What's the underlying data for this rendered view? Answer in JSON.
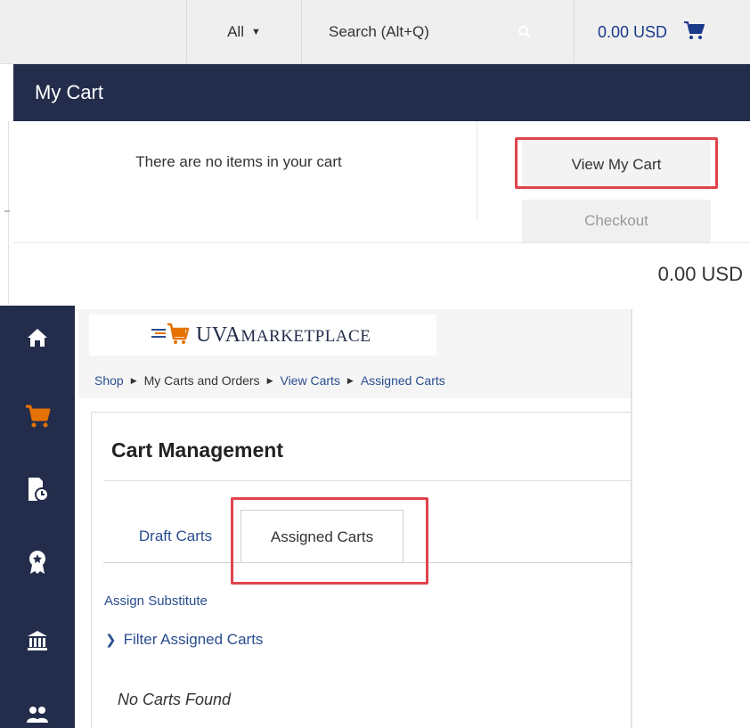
{
  "topbar": {
    "scope_label": "All",
    "search_placeholder": "Search (Alt+Q)",
    "cart_total": "0.00 USD"
  },
  "my_cart": {
    "title": "My Cart",
    "empty_message": "There are no items in your cart",
    "view_cart_label": "View My Cart",
    "checkout_label": "Checkout",
    "total": "0.00 USD"
  },
  "sidebar": {
    "items": [
      {
        "icon": "home-icon"
      },
      {
        "icon": "shopping-cart-icon",
        "active": true
      },
      {
        "icon": "document-clock-icon"
      },
      {
        "icon": "award-badge-icon"
      },
      {
        "icon": "bank-building-icon"
      },
      {
        "icon": "users-icon"
      }
    ]
  },
  "logo": {
    "text_prefix": "UVA",
    "text_main": "MARKETPLACE"
  },
  "breadcrumb": {
    "items": [
      "Shop",
      "My Carts and Orders",
      "View Carts",
      "Assigned Carts"
    ]
  },
  "cart_management": {
    "title": "Cart Management",
    "tabs": [
      {
        "label": "Draft Carts",
        "active": false
      },
      {
        "label": "Assigned Carts",
        "active": true
      }
    ],
    "assign_substitute_label": "Assign Substitute",
    "filter_label": "Filter Assigned Carts",
    "empty_message": "No Carts Found"
  },
  "colors": {
    "navy": "#232d4b",
    "orange": "#e57200",
    "link_blue": "#2a4d8f",
    "highlight_red": "#e0434b"
  }
}
